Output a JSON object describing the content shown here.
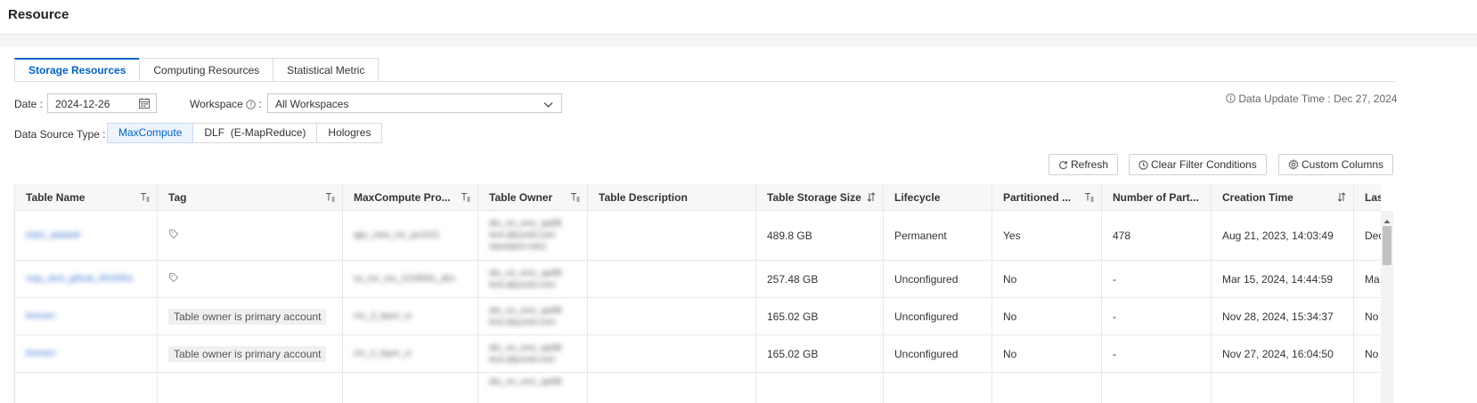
{
  "header": {
    "title": "Resource"
  },
  "tabs": [
    {
      "label": "Storage Resources",
      "active": true
    },
    {
      "label": "Computing Resources",
      "active": false
    },
    {
      "label": "Statistical Metric",
      "active": false
    }
  ],
  "filters": {
    "date_label": "Date :",
    "date_value": "2024-12-26",
    "workspace_label": "Workspace",
    "workspace_colon": ":",
    "workspace_value": "All Workspaces",
    "data_source_label": "Data Source Type :",
    "data_source_options": [
      {
        "label": "MaxCompute",
        "active": true
      },
      {
        "label": "DLF  (E-MapReduce)",
        "active": false
      },
      {
        "label": "Hologres",
        "active": false
      }
    ]
  },
  "update_time": {
    "label": "Data Update Time :",
    "value": "Dec 27, 2024"
  },
  "toolbar": {
    "refresh": "Refresh",
    "clear_filters": "Clear Filter Conditions",
    "custom_columns": "Custom Columns"
  },
  "table": {
    "columns": [
      "Table Name",
      "Tag",
      "MaxCompute Pro...",
      "Table Owner",
      "Table Description",
      "Table Storage Size",
      "Lifecycle",
      "Partitioned ...",
      "Number of Part...",
      "Creation Time",
      "Las"
    ],
    "rows": [
      {
        "name": "tmp1_aaaaub",
        "tag": "",
        "project": "qpc_new_mc_pc1101",
        "owner": "dio_on_emr_qa0B test.aliyunid.com standard-role2",
        "description": "",
        "size": "489.8 GB",
        "lifecycle": "Permanent",
        "partitioned": "Yes",
        "partitions": "478",
        "created": "Aug 21, 2023, 14:03:49",
        "last": "Dec"
      },
      {
        "name": "rsqu_dvvt_github_3015001",
        "tag": "",
        "project": "ss_mc_ms_1218001_dev",
        "owner": "dio_on_emr_qa0B test.aliyunid.com",
        "description": "",
        "size": "257.48 GB",
        "lifecycle": "Unconfigured",
        "partitioned": "No",
        "partitions": "-",
        "created": "Mar 15, 2024, 14:44:59",
        "last": "Ma"
      },
      {
        "name": "linerarn",
        "tag": "Table owner is primary account",
        "project": "mc_3_layer_cr",
        "owner": "dio_on_emr_qa0B test.aliyunid.com",
        "description": "",
        "size": "165.02 GB",
        "lifecycle": "Unconfigured",
        "partitioned": "No",
        "partitions": "-",
        "created": "Nov 28, 2024, 15:34:37",
        "last": "No"
      },
      {
        "name": "linerarn",
        "tag": "Table owner is primary account",
        "project": "mc_2_layer_cr",
        "owner": "dio_on_emr_qa0B test.aliyunid.com",
        "description": "",
        "size": "165.02 GB",
        "lifecycle": "Unconfigured",
        "partitioned": "No",
        "partitions": "-",
        "created": "Nov 27, 2024, 16:04:50",
        "last": "No"
      },
      {
        "name": "",
        "tag": "",
        "project": "",
        "owner": "dio_on_emr_qa0B",
        "description": "",
        "size": "",
        "lifecycle": "",
        "partitioned": "",
        "partitions": "",
        "created": "",
        "last": ""
      }
    ]
  }
}
